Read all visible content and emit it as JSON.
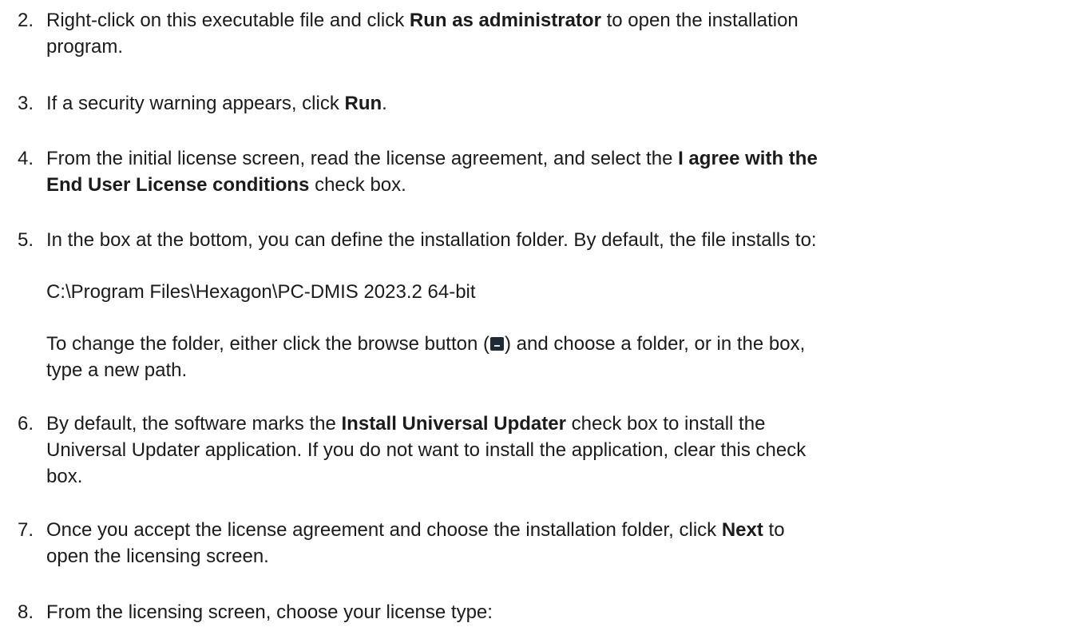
{
  "steps": [
    {
      "num": "2.",
      "line1": {
        "pre": "Right-click on this executable file and click ",
        "bold": "Run as administrator",
        "post": " to open the installation"
      },
      "line2": "program."
    },
    {
      "num": "3.",
      "line1": {
        "pre": "If a security warning appears, click ",
        "bold": "Run",
        "post": "."
      }
    },
    {
      "num": "4.",
      "line1": {
        "pre": "From the initial license screen, read the license agreement, and select the ",
        "bold": "I agree with the"
      },
      "line2": {
        "bold": "End User License conditions",
        "post": " check box."
      }
    },
    {
      "num": "5.",
      "line1": "In the box at the bottom, you can define the installation folder. By default, the file installs to:",
      "path": "C:\\Program Files\\Hexagon\\PC-DMIS 2023.2 64-bit",
      "change1": {
        "pre": "To change the folder, either click the browse button (",
        "post": ") and choose a folder, or in the box,"
      },
      "change2": "type a new path."
    },
    {
      "num": "6.",
      "line1": {
        "pre": "By default, the software marks the ",
        "bold": "Install Universal Updater",
        "post": " check box to install the"
      },
      "line2": "Universal Updater application. If you do not want to install the application, clear this check",
      "line3": "box."
    },
    {
      "num": "7.",
      "line1": {
        "pre": "Once you accept the license agreement and choose the installation folder, click ",
        "bold": "Next",
        "post": " to"
      },
      "line2": "open the licensing screen."
    },
    {
      "num": "8.",
      "line1": "From the licensing screen, choose your license type:"
    }
  ],
  "icons": {
    "browse": "browse-button-icon"
  }
}
